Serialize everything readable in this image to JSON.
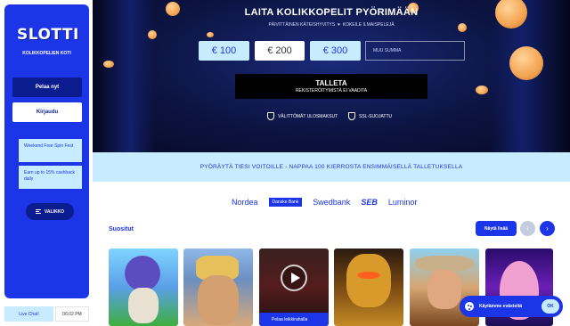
{
  "brand": {
    "logo": "SLOTTI",
    "tagline": "KOLIKKOPELIEN KOTI",
    "colors": {
      "primary": "#1c35e6",
      "dark": "#0b1c8f",
      "light": "#c7ecff"
    }
  },
  "sidebar": {
    "play_label": "Pelaa nyt",
    "login_label": "Kirjaudu",
    "promos": [
      {
        "label": "Weekend Free Spin Fest"
      },
      {
        "label": "Earn up to 15% cashback daily"
      }
    ],
    "menu_label": "VALIKKO",
    "menu_icon": "hamburger-icon"
  },
  "footer": {
    "chat_label": "Live Chat!",
    "time": "06:02 PM"
  },
  "hero": {
    "title": "LAITA KOLIKKOPELIT PYÖRIMÄÄN",
    "subtitle_left": "PÄIVITTÄINEN KÄTEISHYVITYS",
    "subtitle_right": "KOKEILE ILMAISPELEJÄ",
    "amounts": [
      "€ 100",
      "€ 200",
      "€ 300"
    ],
    "selected_amount": "€ 200",
    "custom_amount_placeholder": "MUU SUMMA",
    "deposit_label": "TALLETA",
    "deposit_sub": "REKISTERÖITYMISTÄ EI VAADITA",
    "badges": [
      {
        "label": "VÄLITTÖMÄT ULOSMAKSUT",
        "icon": "shield-icon"
      },
      {
        "label": "SSL-SUOJATTU",
        "icon": "shield-icon"
      }
    ]
  },
  "promo_strip": "PYÖRÄYTÄ TIESI VOITOILLE - NAPPAA 100 KIERROSTA ENSIMMÄISELLÄ TALLETUKSELLA",
  "banks": [
    "Nordea",
    "Danske Bank",
    "Swedbank",
    "SEB",
    "Luminor"
  ],
  "popular": {
    "title": "Suositut",
    "show_more": "Näytä lisää",
    "prev_icon": "chevron-left-icon",
    "next_icon": "chevron-right-icon",
    "demo_label": "Pelaa leikkirahalla"
  },
  "cookie": {
    "text": "Käytämme evästeitä",
    "ok_label": "OK",
    "icon": "cookie-icon"
  }
}
